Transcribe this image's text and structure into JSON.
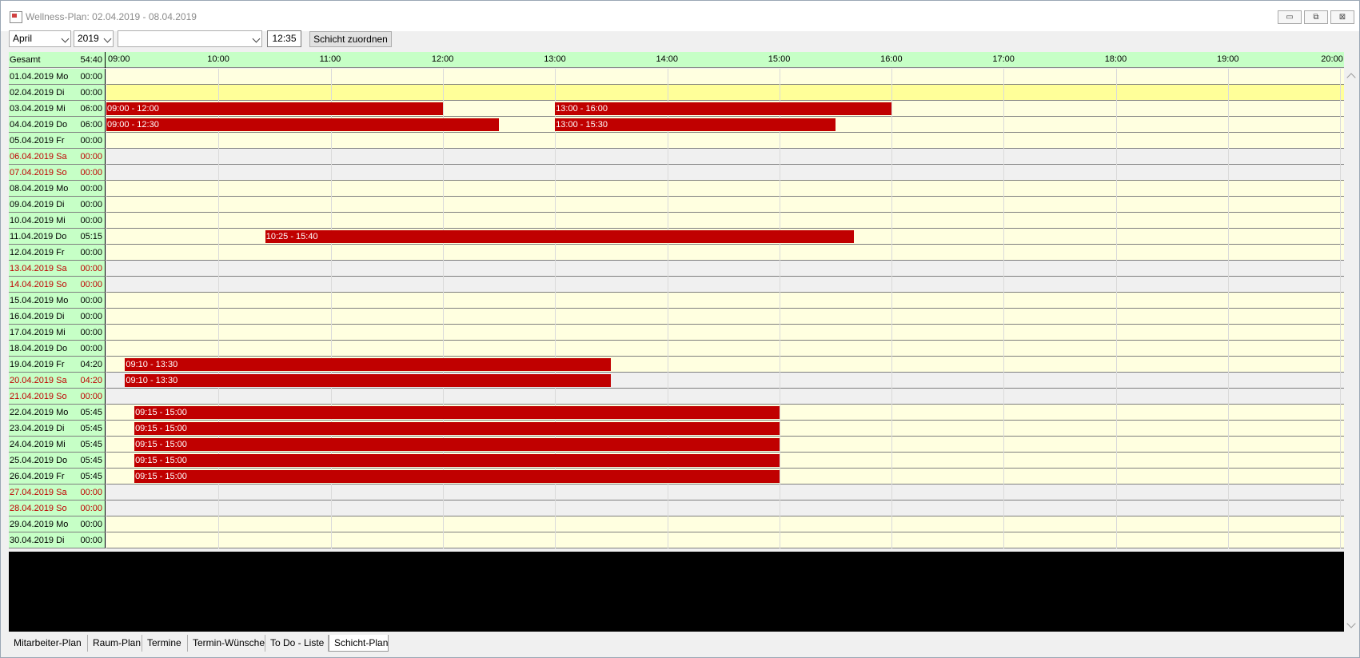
{
  "window": {
    "title": "Wellness-Plan: 02.04.2019 - 08.04.2019",
    "controls": {
      "minimize": "▭",
      "restore": "⧉",
      "close": "⊠"
    }
  },
  "toolbar": {
    "month": "April",
    "year": "2019",
    "employee": "",
    "time": "12:35",
    "assign_button": "Schicht zuordnen"
  },
  "grid": {
    "total_label": "Gesamt",
    "total_duration": "54:40",
    "start_hour_label": "09:00",
    "hours": [
      "10:00",
      "11:00",
      "12:00",
      "13:00",
      "14:00",
      "15:00",
      "16:00",
      "17:00",
      "18:00",
      "19:00",
      "20:00"
    ],
    "rows": [
      {
        "date": "01.04.2019 Mo",
        "duration": "00:00",
        "weekend": false,
        "shifts": []
      },
      {
        "date": "02.04.2019 Di",
        "duration": "00:00",
        "weekend": false,
        "selected": true,
        "shifts": []
      },
      {
        "date": "03.04.2019 Mi",
        "duration": "06:00",
        "weekend": false,
        "shifts": [
          {
            "label": "09:00 - 12:00",
            "start": 9.0,
            "end": 12.0
          },
          {
            "label": "13:00 - 16:00",
            "start": 13.0,
            "end": 16.0
          }
        ]
      },
      {
        "date": "04.04.2019 Do",
        "duration": "06:00",
        "weekend": false,
        "shifts": [
          {
            "label": "09:00 - 12:30",
            "start": 9.0,
            "end": 12.5
          },
          {
            "label": "13:00 - 15:30",
            "start": 13.0,
            "end": 15.5
          }
        ]
      },
      {
        "date": "05.04.2019 Fr",
        "duration": "00:00",
        "weekend": false,
        "shifts": []
      },
      {
        "date": "06.04.2019 Sa",
        "duration": "00:00",
        "weekend": true,
        "shifts": []
      },
      {
        "date": "07.04.2019 So",
        "duration": "00:00",
        "weekend": true,
        "shifts": []
      },
      {
        "date": "08.04.2019 Mo",
        "duration": "00:00",
        "weekend": false,
        "shifts": []
      },
      {
        "date": "09.04.2019 Di",
        "duration": "00:00",
        "weekend": false,
        "shifts": []
      },
      {
        "date": "10.04.2019 Mi",
        "duration": "00:00",
        "weekend": false,
        "shifts": []
      },
      {
        "date": "11.04.2019 Do",
        "duration": "05:15",
        "weekend": false,
        "shifts": [
          {
            "label": "10:25 - 15:40",
            "start": 10.4167,
            "end": 15.6667
          }
        ]
      },
      {
        "date": "12.04.2019 Fr",
        "duration": "00:00",
        "weekend": false,
        "shifts": []
      },
      {
        "date": "13.04.2019 Sa",
        "duration": "00:00",
        "weekend": true,
        "shifts": []
      },
      {
        "date": "14.04.2019 So",
        "duration": "00:00",
        "weekend": true,
        "shifts": []
      },
      {
        "date": "15.04.2019 Mo",
        "duration": "00:00",
        "weekend": false,
        "shifts": []
      },
      {
        "date": "16.04.2019 Di",
        "duration": "00:00",
        "weekend": false,
        "shifts": []
      },
      {
        "date": "17.04.2019 Mi",
        "duration": "00:00",
        "weekend": false,
        "shifts": []
      },
      {
        "date": "18.04.2019 Do",
        "duration": "00:00",
        "weekend": false,
        "shifts": []
      },
      {
        "date": "19.04.2019 Fr",
        "duration": "04:20",
        "weekend": false,
        "shifts": [
          {
            "label": "09:10 - 13:30",
            "start": 9.1667,
            "end": 13.5
          }
        ]
      },
      {
        "date": "20.04.2019 Sa",
        "duration": "04:20",
        "weekend": true,
        "shifts": [
          {
            "label": "09:10 - 13:30",
            "start": 9.1667,
            "end": 13.5
          }
        ]
      },
      {
        "date": "21.04.2019 So",
        "duration": "00:00",
        "weekend": true,
        "shifts": []
      },
      {
        "date": "22.04.2019 Mo",
        "duration": "05:45",
        "weekend": false,
        "shifts": [
          {
            "label": "09:15 - 15:00",
            "start": 9.25,
            "end": 15.0
          }
        ]
      },
      {
        "date": "23.04.2019 Di",
        "duration": "05:45",
        "weekend": false,
        "shifts": [
          {
            "label": "09:15 - 15:00",
            "start": 9.25,
            "end": 15.0
          }
        ]
      },
      {
        "date": "24.04.2019 Mi",
        "duration": "05:45",
        "weekend": false,
        "shifts": [
          {
            "label": "09:15 - 15:00",
            "start": 9.25,
            "end": 15.0
          }
        ]
      },
      {
        "date": "25.04.2019 Do",
        "duration": "05:45",
        "weekend": false,
        "shifts": [
          {
            "label": "09:15 - 15:00",
            "start": 9.25,
            "end": 15.0
          }
        ]
      },
      {
        "date": "26.04.2019 Fr",
        "duration": "05:45",
        "weekend": false,
        "shifts": [
          {
            "label": "09:15 - 15:00",
            "start": 9.25,
            "end": 15.0
          }
        ]
      },
      {
        "date": "27.04.2019 Sa",
        "duration": "00:00",
        "weekend": true,
        "shifts": []
      },
      {
        "date": "28.04.2019 So",
        "duration": "00:00",
        "weekend": true,
        "shifts": []
      },
      {
        "date": "29.04.2019 Mo",
        "duration": "00:00",
        "weekend": false,
        "shifts": []
      },
      {
        "date": "30.04.2019 Di",
        "duration": "00:00",
        "weekend": false,
        "shifts": []
      }
    ]
  },
  "tabs": [
    {
      "label": "Mitarbeiter-Plan",
      "active": false
    },
    {
      "label": "Raum-Plan",
      "active": false
    },
    {
      "label": "Termine",
      "active": false
    },
    {
      "label": "Termin-Wünsche",
      "active": false
    },
    {
      "label": "To Do - Liste",
      "active": false
    },
    {
      "label": "Schicht-Plan",
      "active": true
    }
  ],
  "colors": {
    "shift": "#c00000",
    "date_column": "#c6ffc6",
    "weekday_lane": "#ffffe0",
    "weekend_lane": "#f0f0f0",
    "selected_lane": "#ffff99",
    "weekend_text": "#c00000"
  }
}
